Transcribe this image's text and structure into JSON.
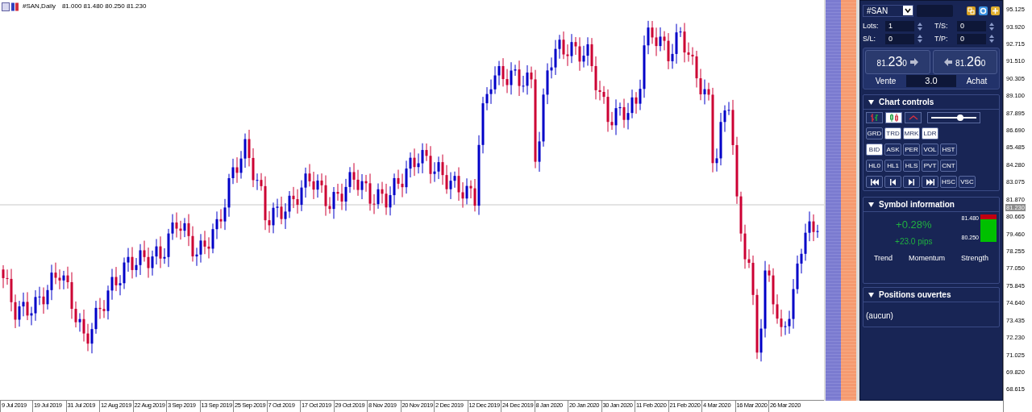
{
  "title": {
    "symbol": "#SAN,Daily",
    "ohlc": "81.000 81.480 80.250 81.230"
  },
  "price_axis": {
    "labels": [
      "95.125",
      "93.920",
      "92.715",
      "91.510",
      "90.305",
      "89.100",
      "87.895",
      "86.690",
      "85.485",
      "84.280",
      "83.075",
      "81.870",
      "80.665",
      "79.460",
      "78.255",
      "77.050",
      "75.845",
      "74.640",
      "73.435",
      "72.230",
      "71.025",
      "69.820",
      "68.615"
    ],
    "current": "81.230"
  },
  "time_axis": {
    "labels": [
      "9 Jul 2019",
      "19 Jul 2019",
      "31 Jul 2019",
      "12 Aug 2019",
      "22 Aug 2019",
      "3 Sep 2019",
      "13 Sep 2019",
      "25 Sep 2019",
      "7 Oct 2019",
      "17 Oct 2019",
      "29 Oct 2019",
      "8 Nov 2019",
      "20 Nov 2019",
      "2 Dec 2019",
      "12 Dec 2019",
      "24 Dec 2019",
      "8 Jan 2020",
      "20 Jan 2020",
      "30 Jan 2020",
      "11 Feb 2020",
      "21 Feb 2020",
      "4 Mar 2020",
      "16 Mar 2020",
      "26 Mar 2020"
    ]
  },
  "panel": {
    "symbol": "#SAN",
    "fields": [
      {
        "label": "Lots:",
        "value": "1"
      },
      {
        "label": "T/S:",
        "value": "0"
      },
      {
        "label": "S/L:",
        "value": "0"
      },
      {
        "label": "T/P:",
        "value": "0"
      }
    ],
    "sell": {
      "price_prefix": "81.",
      "price_big": "23",
      "price_suffix": "0",
      "label": "Vente"
    },
    "spread": "3.0",
    "buy": {
      "price_prefix": "81.",
      "price_big": "26",
      "price_suffix": "0",
      "label": "Achat"
    },
    "chart_controls": {
      "title": "Chart controls",
      "expanded": true,
      "mode_buttons": [
        {
          "kind": "bars",
          "selected": false
        },
        {
          "kind": "candles",
          "selected": true
        },
        {
          "kind": "line",
          "selected": false
        }
      ],
      "zoom": {
        "level": 0.65
      },
      "button_rows": [
        [
          {
            "kind": "text",
            "label": "GRD",
            "selected": false
          },
          {
            "kind": "text",
            "label": "TRD",
            "selected": true
          },
          {
            "kind": "text",
            "label": "MRK",
            "selected": true
          },
          {
            "kind": "text",
            "label": "LDR",
            "selected": true
          }
        ],
        [
          {
            "kind": "text",
            "label": "BID",
            "selected": true
          },
          {
            "kind": "text",
            "label": "ASK",
            "selected": false
          },
          {
            "kind": "text",
            "label": "PER",
            "selected": false
          },
          {
            "kind": "text",
            "label": "VOL",
            "selected": false
          },
          {
            "kind": "text",
            "label": "HST",
            "selected": false
          }
        ],
        [
          {
            "kind": "text",
            "label": "HL0",
            "selected": false
          },
          {
            "kind": "text",
            "label": "HL1",
            "selected": false
          },
          {
            "kind": "text",
            "label": "HLS",
            "selected": false
          },
          {
            "kind": "text",
            "label": "PVT",
            "selected": false
          },
          {
            "kind": "text",
            "label": "CNT",
            "selected": false
          }
        ],
        [
          {
            "kind": "first",
            "selected": false
          },
          {
            "kind": "prev",
            "selected": false
          },
          {
            "kind": "next",
            "selected": false
          },
          {
            "kind": "last",
            "selected": false
          },
          {
            "kind": "text",
            "label": "HSC",
            "selected": false
          },
          {
            "kind": "text",
            "label": "VSC",
            "selected": false
          }
        ]
      ]
    },
    "symbol_info": {
      "title": "Symbol information",
      "expanded": true,
      "change": "+0.28%",
      "pips": "+23.0 pips",
      "high": "81.480",
      "low": "80.250",
      "indicators": [
        "Trend",
        "Momentum",
        "Strength"
      ]
    },
    "positions": {
      "title": "Positions ouvertes",
      "expanded": true,
      "empty_text": "(aucun)"
    }
  }
}
